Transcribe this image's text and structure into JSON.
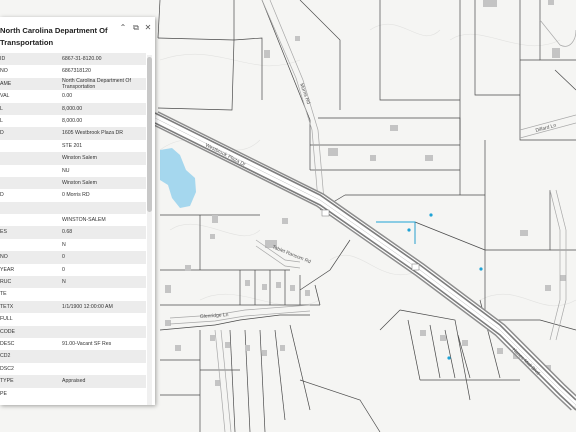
{
  "popup": {
    "title": "North Carolina Department Of Transportation",
    "controls": {
      "collapse": "⌃",
      "dock": "⧉",
      "close": "✕"
    },
    "rows": [
      {
        "key": "ID",
        "value": "6867-31-8120.00"
      },
      {
        "key": "NO",
        "value": "6867318120"
      },
      {
        "key": "AME",
        "value": "North Carolina Department Of Transportation"
      },
      {
        "key": "VAL",
        "value": "0.00"
      },
      {
        "key": "L",
        "value": "8,000.00"
      },
      {
        "key": "L",
        "value": "8,000.00"
      },
      {
        "key": "D",
        "value": "1605 Westbrook Plaza DR"
      },
      {
        "key": "",
        "value": "STE 201"
      },
      {
        "key": "",
        "value": "Winston Salem"
      },
      {
        "key": "",
        "value": "NU"
      },
      {
        "key": "",
        "value": "Winston Salem"
      },
      {
        "key": "D",
        "value": "0 Morris RD"
      },
      {
        "key": "",
        "value": ""
      },
      {
        "key": "",
        "value": "WINSTON-SALEM"
      },
      {
        "key": "ES",
        "value": "0.68"
      },
      {
        "key": "",
        "value": "N"
      },
      {
        "key": "NO",
        "value": "0"
      },
      {
        "key": "YEAR",
        "value": "0"
      },
      {
        "key": "RUC",
        "value": "N"
      },
      {
        "key": "TE",
        "value": ""
      },
      {
        "key": "TETX",
        "value": "1/1/1900 12:00:00 AM"
      },
      {
        "key": "FULL",
        "value": ""
      },
      {
        "key": "CODE",
        "value": ""
      },
      {
        "key": "DESC",
        "value": "91.00-Vacant SF Res"
      },
      {
        "key": "CD2",
        "value": ""
      },
      {
        "key": "DSC2",
        "value": ""
      },
      {
        "key": "TYPE",
        "value": "Appraised"
      },
      {
        "key": "PE",
        "value": ""
      }
    ]
  },
  "map": {
    "road_labels": [
      "Morris Rd",
      "Westbrook Plaza Dr",
      "Tablet Ransom Rd",
      "Glenridge Ln",
      "Dillard Ln",
      "Hanes Mall Blvd"
    ],
    "colors": {
      "background": "#f4f4f2",
      "road_casing": "#9a9a9a",
      "road_fill": "#ffffff",
      "parcel_line": "#444444",
      "water": "#a5d7ee",
      "highlight": "#1fa3d6",
      "building": "#bdbdbd"
    }
  }
}
